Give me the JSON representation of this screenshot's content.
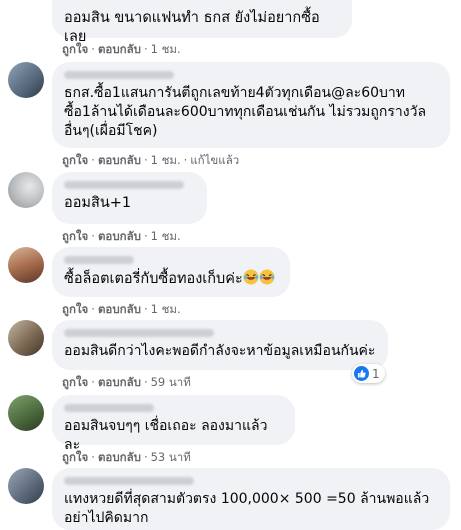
{
  "comments": [
    {
      "text": "ออมสิน ขนาดแฟนทำ ธกส ยังไม่อยากซื้อเลย",
      "actions": {
        "like": "ถูกใจ",
        "reply": "ตอบกลับ",
        "time": "1 ชม."
      }
    },
    {
      "text": "ธกส.ซื้อ1แสนการันตีถูกเลขท้าย4ตัวทุกเดือน@ละ60บาท\nซื้อ1ล้านได้เดือนละ600บาททุกเดือนเช่นกัน ไม่รวมถูกรางวัล\nอื่นๆ(เผื่อมีโชค)",
      "actions": {
        "like": "ถูกใจ",
        "reply": "ตอบกลับ",
        "time": "1 ชม.",
        "edited": "แก้ไขแล้ว"
      }
    },
    {
      "text": "ออมสิน+1",
      "actions": {
        "like": "ถูกใจ",
        "reply": "ตอบกลับ",
        "time": "1 ชม."
      }
    },
    {
      "text": "ซื้อล็อตเตอรี่กับซื้อทองเก็บค่ะ",
      "emoji": "laughing-crying-emoji",
      "actions": {
        "like": "ถูกใจ",
        "reply": "ตอบกลับ",
        "time": "1 ชม."
      }
    },
    {
      "text": "ออมสินดีกว่าไงคะพอดีกำลังจะหาข้อมูลเหมือนกันค่ะ",
      "actions": {
        "like": "ถูกใจ",
        "reply": "ตอบกลับ",
        "time": "59 นาที"
      },
      "reaction": {
        "icon": "like-icon",
        "count": "1",
        "color": "#1877f2"
      }
    },
    {
      "text": "ออมสินจบๆๆ เชื่อเถอะ ลองมาแล้วละ",
      "actions": {
        "like": "ถูกใจ",
        "reply": "ตอบกลับ",
        "time": "53 นาที"
      }
    },
    {
      "text": "แทงหวยดีที่สุดสามตัวตรง 100,000× 500 =50 ล้านพอแล้ว\nอย่าไปคิดมาก",
      "actions": {}
    }
  ],
  "colors": {
    "bubble": "#f0f2f5",
    "meta": "#65676b",
    "text": "#050505",
    "accent": "#1877f2"
  }
}
